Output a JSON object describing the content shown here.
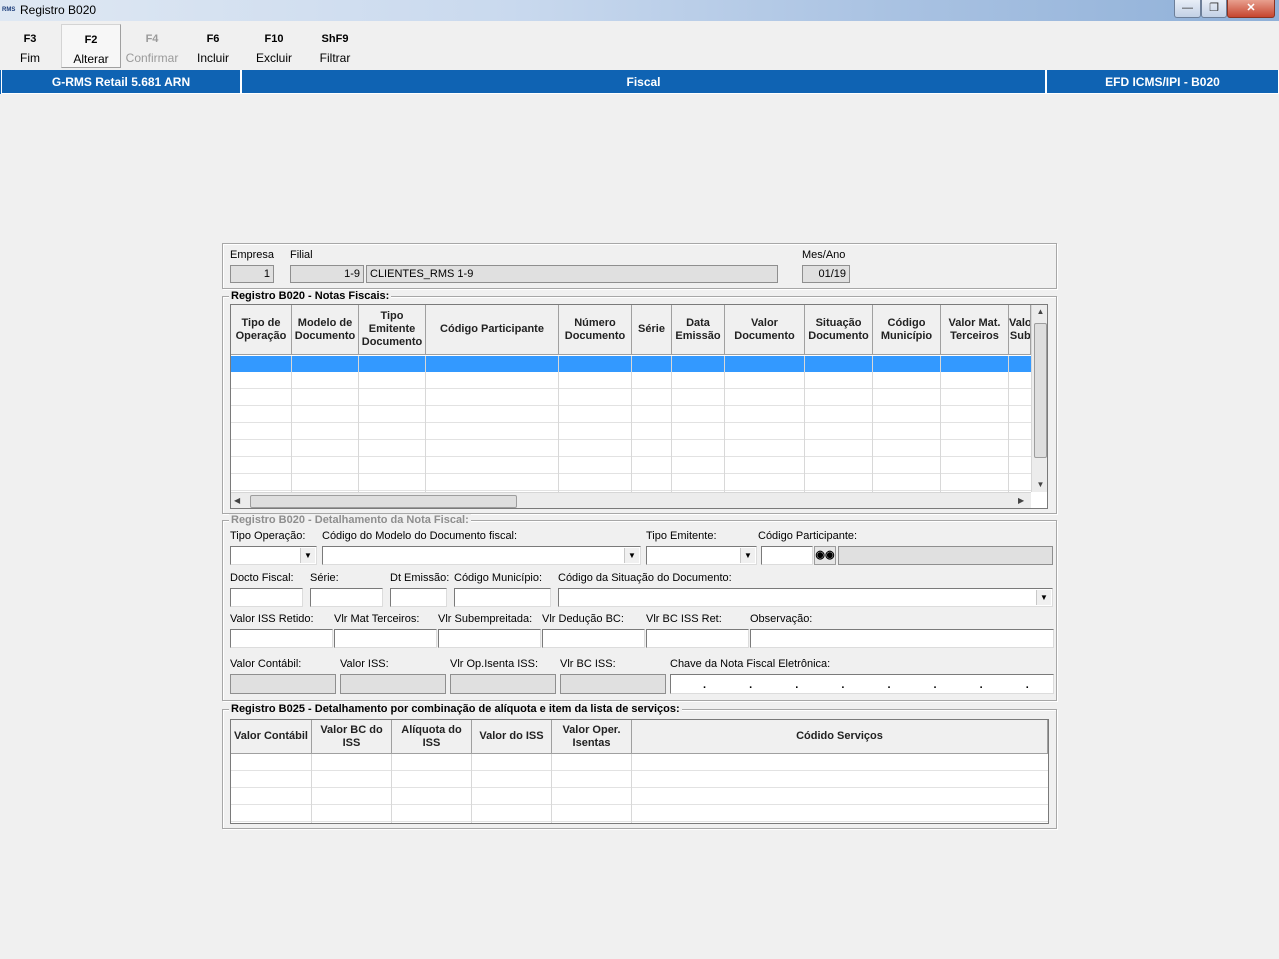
{
  "window": {
    "title": "Registro B020",
    "app_icon_text": "RMS"
  },
  "toolbar": [
    {
      "key": "F3",
      "label": "Fim",
      "state": "normal"
    },
    {
      "key": "F2",
      "label": "Alterar",
      "state": "active"
    },
    {
      "key": "F4",
      "label": "Confirmar",
      "state": "disabled"
    },
    {
      "key": "F6",
      "label": "Incluir",
      "state": "normal"
    },
    {
      "key": "F10",
      "label": "Excluir",
      "state": "normal"
    },
    {
      "key": "ShF9",
      "label": "Filtrar",
      "state": "normal"
    }
  ],
  "header_bar": {
    "system": "G-RMS Retail 5.681 ARN",
    "module": "Fiscal",
    "screen": "EFD ICMS/IPI - B020"
  },
  "top_group": {
    "empresa_label": "Empresa",
    "empresa_value": "1",
    "filial_label": "Filial",
    "filial_code": "1-9",
    "filial_name": "CLIENTES_RMS 1-9",
    "mesano_label": "Mes/Ano",
    "mesano_value": "01/19"
  },
  "notas_group": {
    "title": "Registro B020 - Notas Fiscais:",
    "columns": [
      "Tipo de Operação",
      "Modelo de Documento",
      "Tipo Emitente Documento",
      "Código Participante",
      "Número Documento",
      "Série",
      "Data Emissão",
      "Valor Documento",
      "Situação Documento",
      "Código Município",
      "Valor Mat. Terceiros",
      "Valo Sub"
    ]
  },
  "detalhe_group": {
    "title": "Registro B020 - Detalhamento da Nota Fiscal:",
    "tipo_operacao": "Tipo Operação:",
    "codigo_modelo": "Código do Modelo do Documento fiscal:",
    "tipo_emitente": "Tipo Emitente:",
    "codigo_participante": "Código Participante:",
    "docto_fiscal": "Docto Fiscal:",
    "serie": "Série:",
    "dt_emissao": "Dt Emissão:",
    "codigo_municipio": "Código Município:",
    "codigo_situacao": "Código da Situação do Documento:",
    "valor_iss_retido": "Valor ISS Retido:",
    "vlr_mat_terceiros": "Vlr Mat Terceiros:",
    "vlr_subempreitada": "Vlr Subempreitada:",
    "vlr_deducao_bc": "Vlr Dedução BC:",
    "vlr_bc_iss_ret": "Vlr BC ISS Ret:",
    "observacao": "Observação:",
    "valor_contabil": "Valor Contábil:",
    "valor_iss": "Valor ISS:",
    "vlr_op_isenta_iss": "Vlr Op.Isenta ISS:",
    "vlr_bc_iss": "Vlr BC ISS:",
    "chave_nfe": "Chave da Nota Fiscal Eletrônica:",
    "chave_mask": ". . . . . . . . . ."
  },
  "b025_group": {
    "title": "Registro B025 - Detalhamento por combinação de alíquota e item da lista de serviços:",
    "columns": [
      "Valor Contábil",
      "Valor BC do ISS",
      "Alíquota do ISS",
      "Valor do ISS",
      "Valor Oper. Isentas",
      "Códido Serviços"
    ]
  },
  "icons": {
    "minimize": "minimize-icon",
    "maximize": "maximize-icon",
    "close": "close-icon",
    "search": "binoculars-icon",
    "dropdown": "chevron-down-icon"
  },
  "colors": {
    "header_blue": "#0f63b3",
    "selection_blue": "#3399ff",
    "window_bg": "#f0f0f0"
  }
}
